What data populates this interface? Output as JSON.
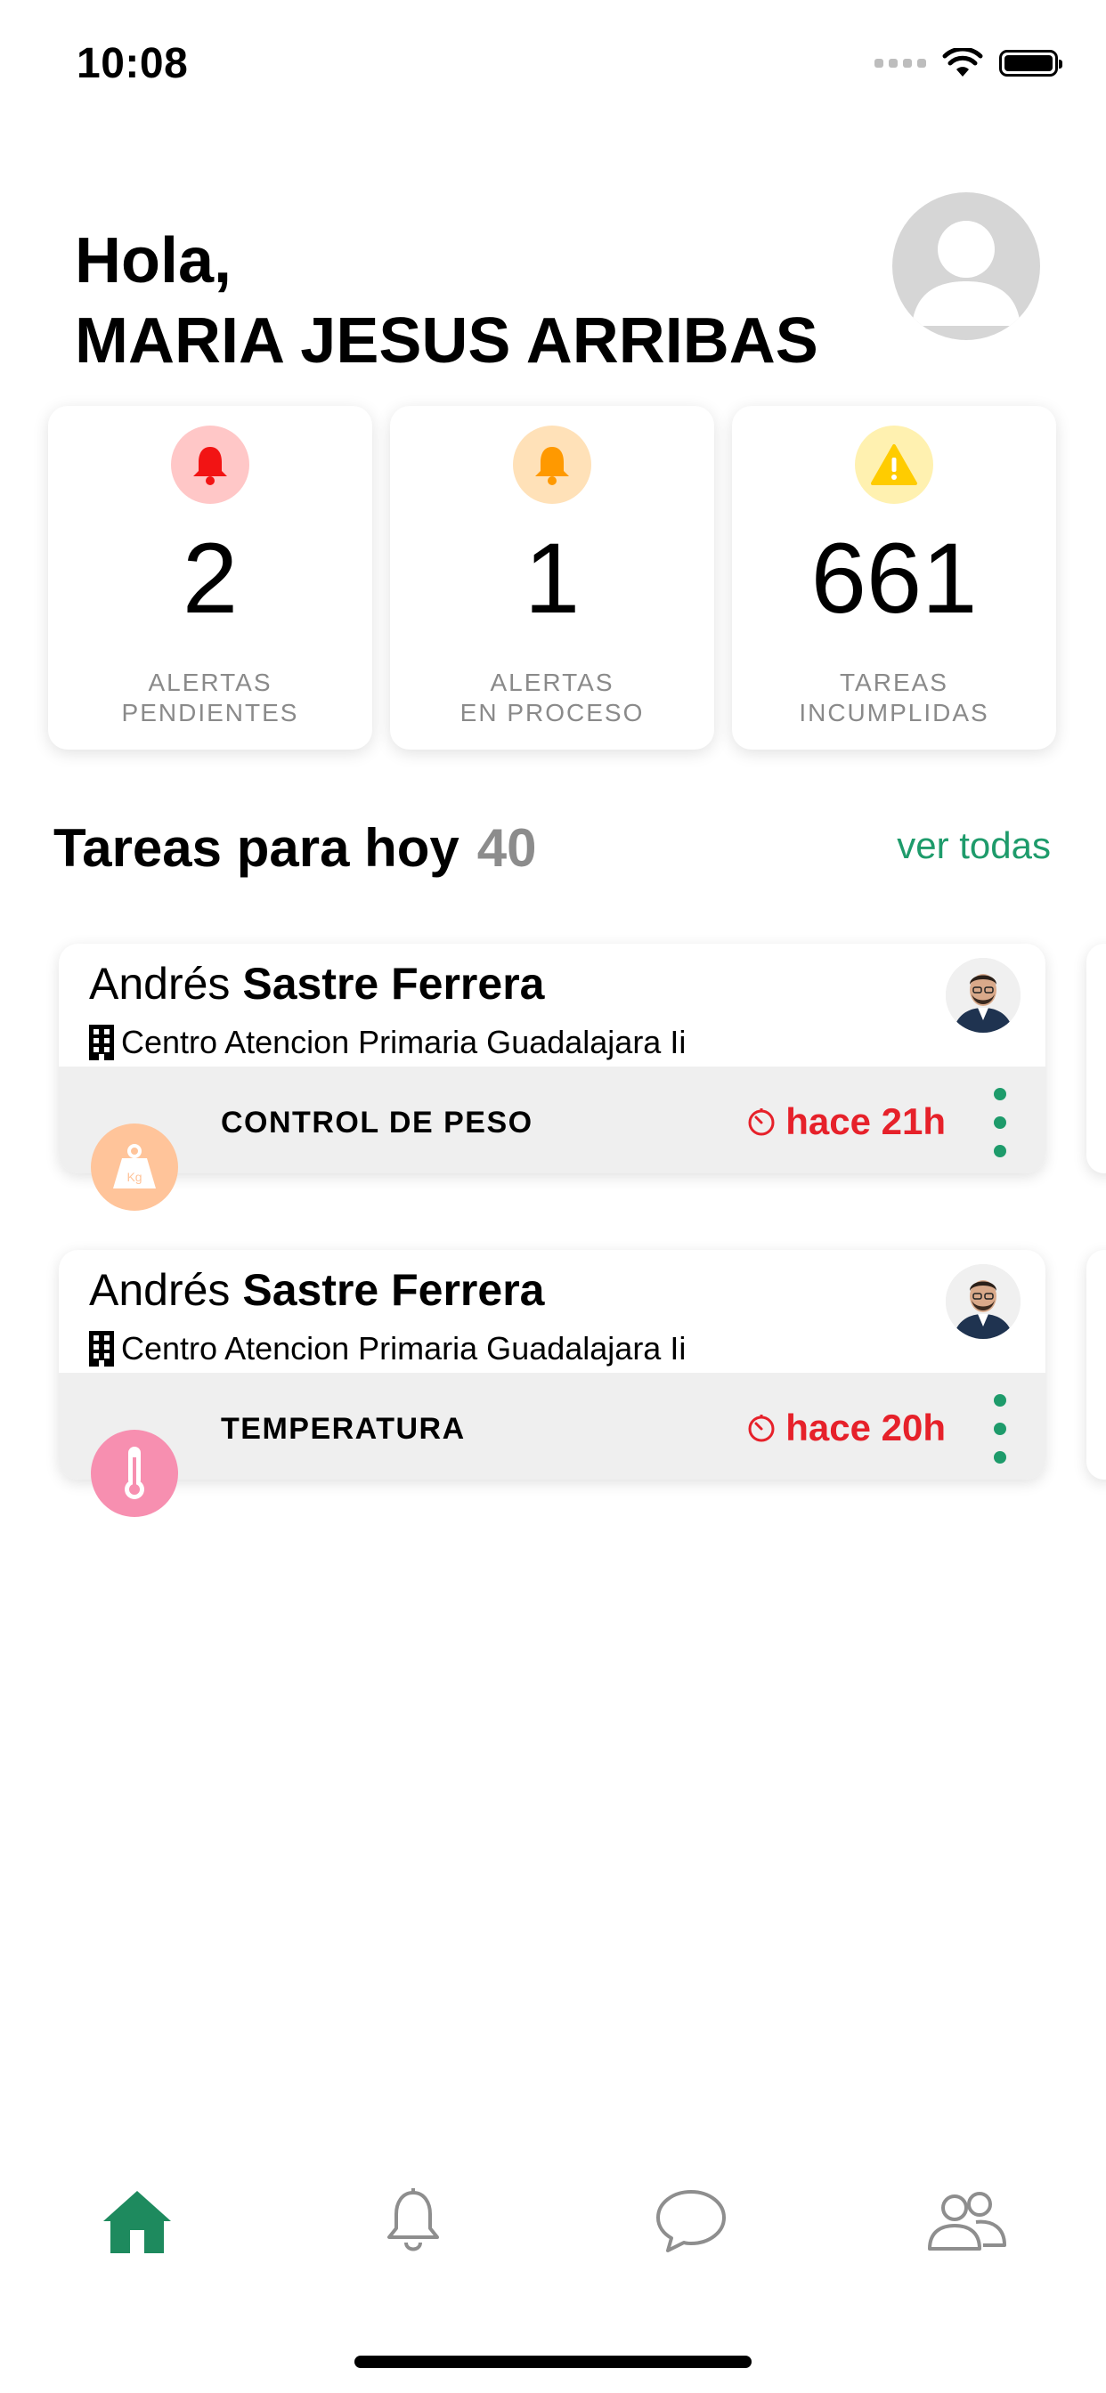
{
  "status_bar": {
    "time": "10:08"
  },
  "header": {
    "greeting": "Hola,",
    "user_name": "MARIA JESUS ARRIBAS"
  },
  "stats": [
    {
      "value": "2",
      "label_line1": "ALERTAS",
      "label_line2": "PENDIENTES",
      "icon": "bell-icon",
      "color": "#f21414",
      "bg": "#ffc7c7"
    },
    {
      "value": "1",
      "label_line1": "ALERTAS",
      "label_line2": "EN PROCESO",
      "icon": "bell-icon",
      "color": "#ff9900",
      "bg": "#ffe1b8"
    },
    {
      "value": "661",
      "label_line1": "TAREAS",
      "label_line2": "INCUMPLIDAS",
      "icon": "warning-icon",
      "color": "#ffcc00",
      "bg": "#fff1b0"
    }
  ],
  "section": {
    "title": "Tareas para hoy",
    "count": "40",
    "see_all": "ver todas"
  },
  "tasks": [
    {
      "first_name": "Andrés",
      "last_name": "Sastre Ferrera",
      "center": "Centro Atencion Primaria Guadalajara Ii",
      "type": "CONTROL DE PESO",
      "due": "hace 21h",
      "icon": "weight-kg-icon",
      "icon_bg": "#ffc49a",
      "icon_text": "Kg"
    },
    {
      "first_name": "Andrés",
      "last_name": "Sastre Ferrera",
      "center": "Centro Atencion Primaria Guadalajara Ii",
      "type": "TEMPERATURA",
      "due": "hace 20h",
      "icon": "thermometer-icon",
      "icon_bg": "#f78fb0"
    }
  ],
  "tab_bar": {
    "items": [
      "home",
      "alerts",
      "messages",
      "patients"
    ],
    "active": "home",
    "active_color": "#1e8a5e",
    "inactive_color": "#8e8e8e"
  }
}
